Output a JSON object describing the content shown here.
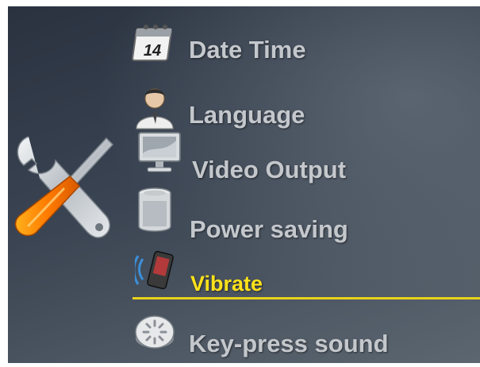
{
  "settings_menu": {
    "emblem_icon": "wrench-screwdriver-icon",
    "selected_index": 4,
    "accent_color": "#ffe11a",
    "items": [
      {
        "label": "Date Time",
        "icon": "calendar-icon",
        "calendar_day": "14"
      },
      {
        "label": "Language",
        "icon": "person-icon"
      },
      {
        "label": "Video Output",
        "icon": "monitor-icon"
      },
      {
        "label": "Power saving",
        "icon": "battery-icon"
      },
      {
        "label": "Vibrate",
        "icon": "vibrating-phone-icon"
      },
      {
        "label": "Key-press sound",
        "icon": "keypress-button-icon"
      }
    ]
  }
}
